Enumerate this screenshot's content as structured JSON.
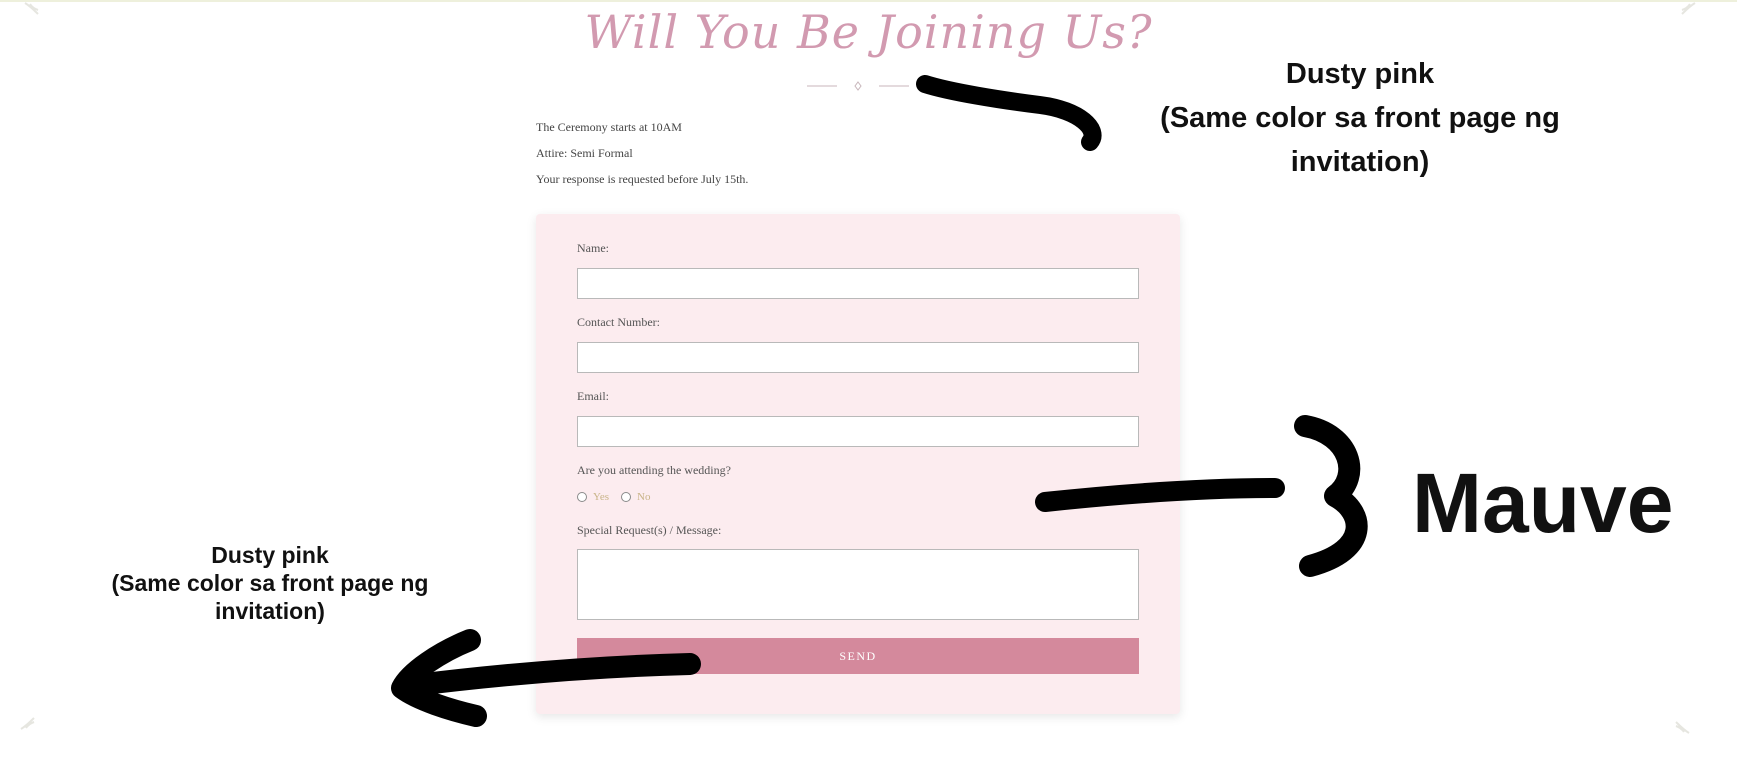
{
  "page": {
    "title": "Will You Be Joining Us?",
    "info_lines": [
      "The Ceremony starts at 10AM",
      "Attire: Semi Formal",
      "Your response is requested before July 15th."
    ]
  },
  "form": {
    "name_label": "Name:",
    "contact_label": "Contact Number:",
    "email_label": "Email:",
    "attending_question": "Are you attending the wedding?",
    "attending_options": [
      "Yes",
      "No"
    ],
    "message_label": "Special Request(s) / Message:",
    "send_label": "SEND"
  },
  "annotations": {
    "top": [
      "Dusty pink",
      "(Same color sa front page ng",
      "invitation)"
    ],
    "left": [
      "Dusty pink",
      "(Same color sa front page ng",
      "invitation)"
    ],
    "right": "Mauve"
  },
  "colors": {
    "title": "#d29ab0",
    "card_background": "#fcecef",
    "send_button": "#d4899c",
    "radio_label": "#c9b488"
  },
  "icons": {
    "corner": "floral-corner-ornament",
    "divider": "diamond-divider-ornament"
  }
}
